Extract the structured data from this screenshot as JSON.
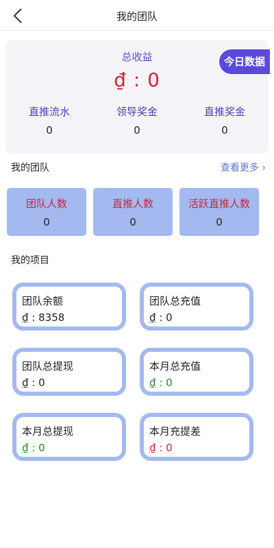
{
  "header": {
    "title": "我的团队",
    "back_icon": "chevron-left-icon"
  },
  "summary": {
    "title": "总收益",
    "value": "₫ : 0",
    "today_button": "今日数据",
    "stats": [
      {
        "label": "直推流水",
        "value": "0"
      },
      {
        "label": "领导奖金",
        "value": "0"
      },
      {
        "label": "直推奖金",
        "value": "0"
      }
    ]
  },
  "team_section": {
    "title": "我的团队",
    "see_more": "查看更多",
    "tiles": [
      {
        "label": "团队人数",
        "value": "0"
      },
      {
        "label": "直推人数",
        "value": "0"
      },
      {
        "label": "活跃直推人数",
        "value": "0"
      }
    ]
  },
  "projects_section": {
    "title": "我的项目",
    "currency": "₫",
    "items": [
      {
        "label": "团队余额",
        "value": ": 8358",
        "color": "#222222"
      },
      {
        "label": "团队总充值",
        "value": ": 0",
        "color": "#222222"
      },
      {
        "label": "团队总提现",
        "value": ": 0",
        "color": "#222222"
      },
      {
        "label": "本月总充值",
        "value": ": 0",
        "color": "#1e8a1e"
      },
      {
        "label": "本月总提现",
        "value": ": 0",
        "color": "#1e8a1e"
      },
      {
        "label": "本月充提差",
        "value": ": 0",
        "color": "#d9213a"
      }
    ]
  },
  "colors": {
    "accent": "#5b49dd",
    "tile": "#a4b9ef",
    "summary_bg": "#f4f4f8"
  }
}
